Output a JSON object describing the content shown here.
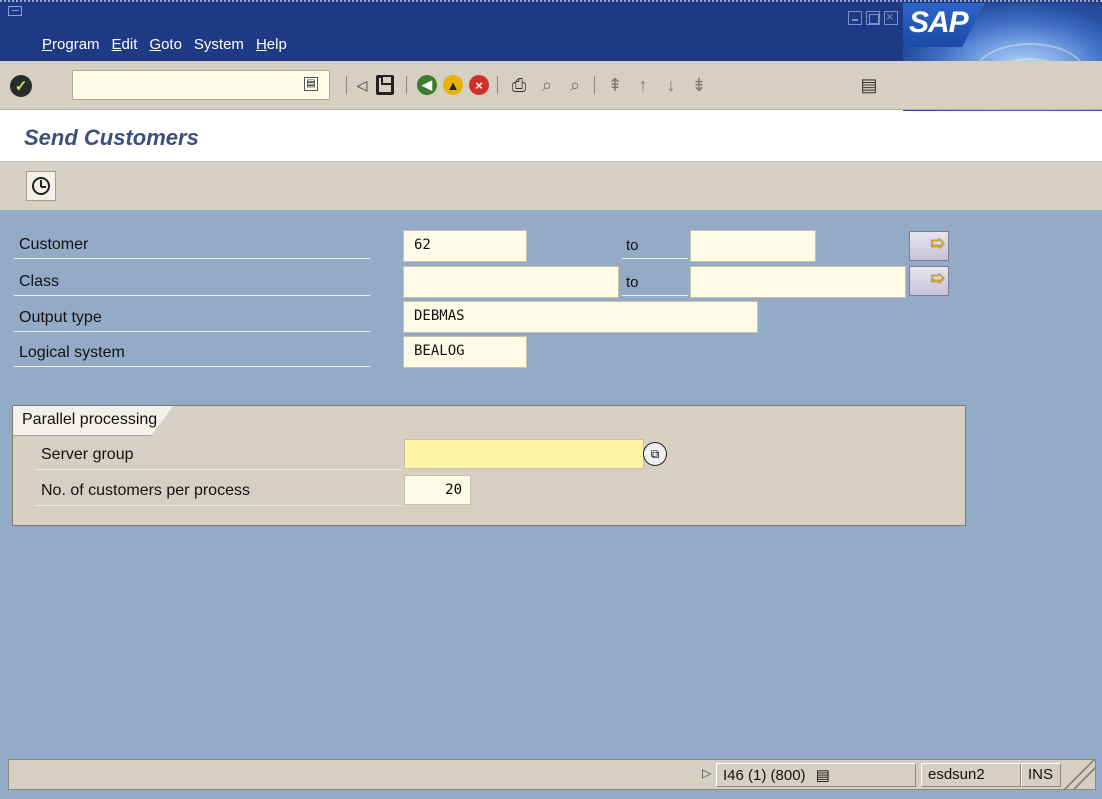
{
  "menu": {
    "items": [
      {
        "u": "P",
        "rest": "rogram"
      },
      {
        "u": "E",
        "rest": "dit"
      },
      {
        "u": "G",
        "rest": "oto"
      },
      {
        "u": "",
        "rest": "System"
      },
      {
        "u": "H",
        "rest": "elp"
      }
    ]
  },
  "logo_text": "SAP",
  "title": "Send Customers",
  "form": {
    "customer_label": "Customer",
    "customer_from": "62",
    "customer_to": "",
    "class_label": "Class",
    "class_from": "",
    "class_to": "",
    "to_label": "to",
    "output_type_label": "Output type",
    "output_type_value": "DEBMAS",
    "logical_system_label": "Logical system",
    "logical_system_value": "BEALOG"
  },
  "parallel": {
    "title": "Parallel processing",
    "server_group_label": "Server group",
    "server_group_value": "",
    "per_process_label": "No. of customers per process",
    "per_process_value": "20"
  },
  "status": {
    "system": "I46 (1) (800)",
    "host": "esdsun2",
    "mode": "INS"
  },
  "icons": {
    "enter": "enter-check-icon",
    "save": "save-icon",
    "back": "back-icon",
    "exit": "exit-icon",
    "cancel": "cancel-icon",
    "execute": "execute-clock-icon"
  }
}
